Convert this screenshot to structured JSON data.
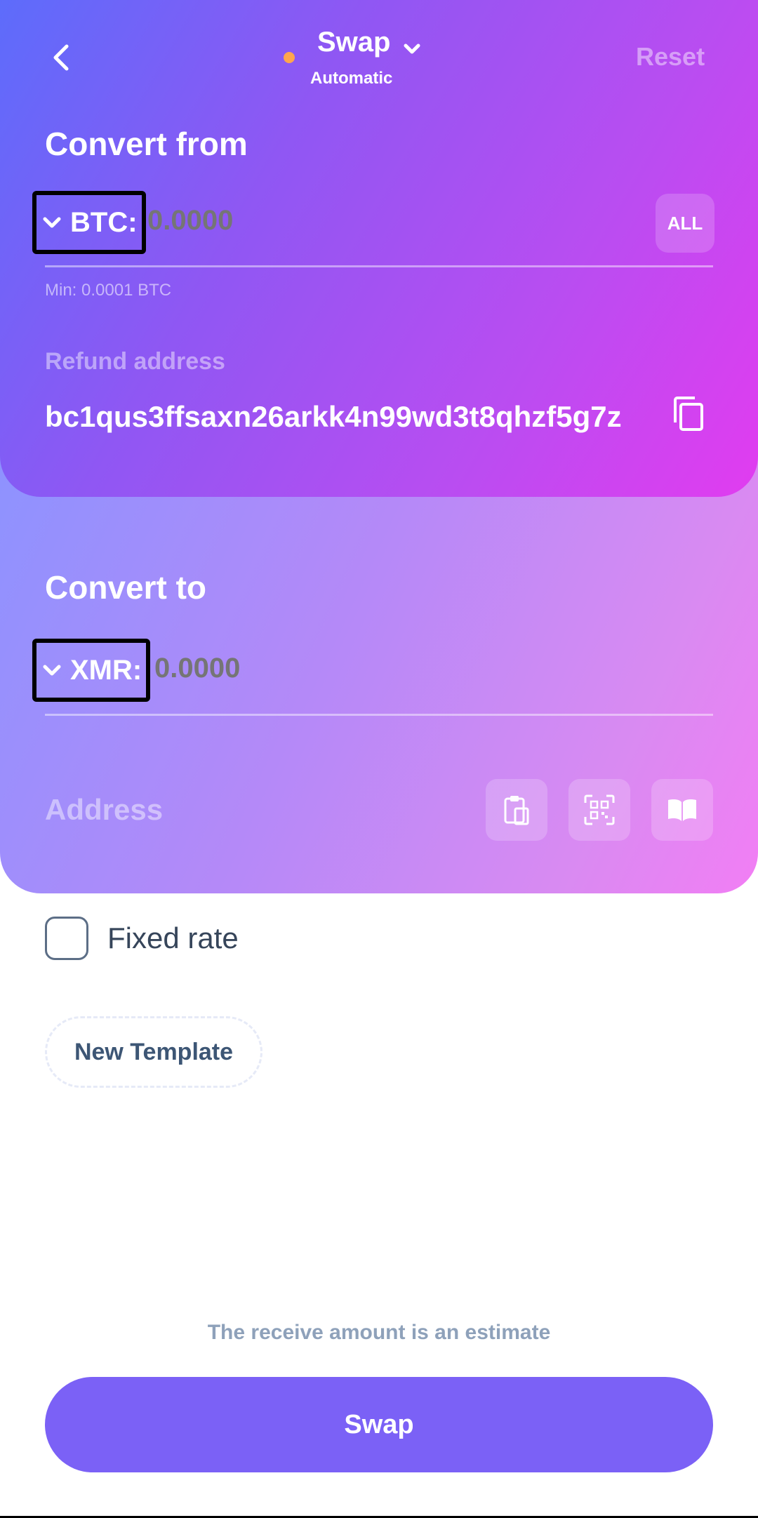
{
  "header": {
    "title": "Swap",
    "subtitle": "Automatic",
    "reset_label": "Reset",
    "status_color": "#ffa64d"
  },
  "convert_from": {
    "section_title": "Convert from",
    "coin_label": "BTC:",
    "amount_placeholder": "0.0000",
    "all_label": "ALL",
    "min_text": "Min: 0.0001 BTC",
    "refund_label": "Refund address",
    "refund_address": "bc1qus3ffsaxn26arkk4n99wd3t8qhzf5g7z"
  },
  "convert_to": {
    "section_title": "Convert to",
    "coin_label": "XMR:",
    "amount_placeholder": "0.0000",
    "address_placeholder": "Address"
  },
  "options": {
    "fixed_rate_label": "Fixed rate",
    "new_template_label": "New Template"
  },
  "footer": {
    "estimate_note": "The receive amount is an estimate",
    "swap_label": "Swap"
  },
  "colors": {
    "accent": "#7b61f6",
    "from_gradient_start": "#5d6cfb",
    "from_gradient_end": "#e13cf0",
    "to_gradient_start": "#8b93ff",
    "to_gradient_end": "#f27ef4"
  },
  "icons": [
    "chevron-left-icon",
    "chevron-down-icon",
    "copy-icon",
    "paste-icon",
    "qr-scan-icon",
    "address-book-icon"
  ]
}
